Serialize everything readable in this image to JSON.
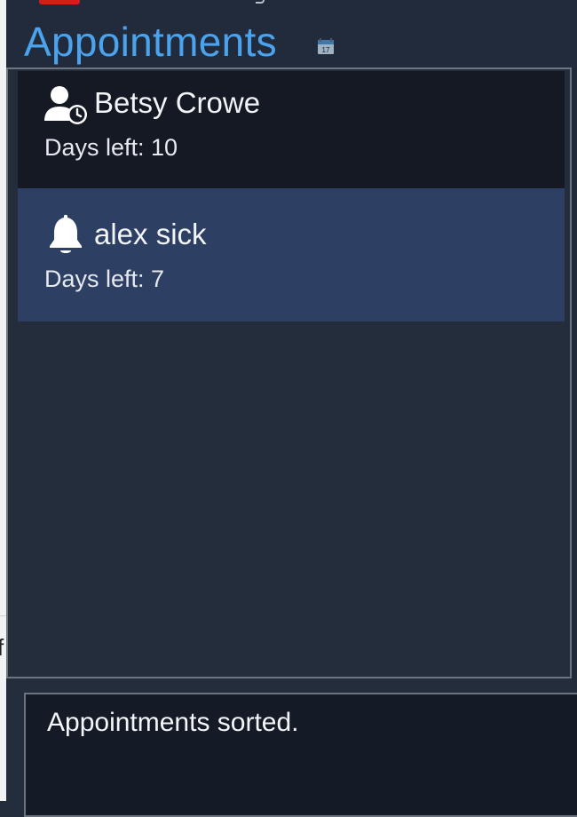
{
  "header": {
    "title": "Appointments",
    "title_color": "#4aa3ec",
    "calendar_icon": "calendar-icon",
    "calendar_day": "17"
  },
  "appointments": [
    {
      "name": "Betsy Crowe",
      "days_label": "Days left: 10",
      "icon": "user-clock-icon",
      "selected": false,
      "background": "#141923"
    },
    {
      "name": "alex sick",
      "days_label": "Days left: 7",
      "icon": "bell-icon",
      "selected": true,
      "background": "#2d4064"
    }
  ],
  "result": {
    "message": "Appointments sorted."
  },
  "colors": {
    "window_bg": "#232d3c",
    "result_bg": "#151b26",
    "accent_red": "#d51c1c"
  }
}
